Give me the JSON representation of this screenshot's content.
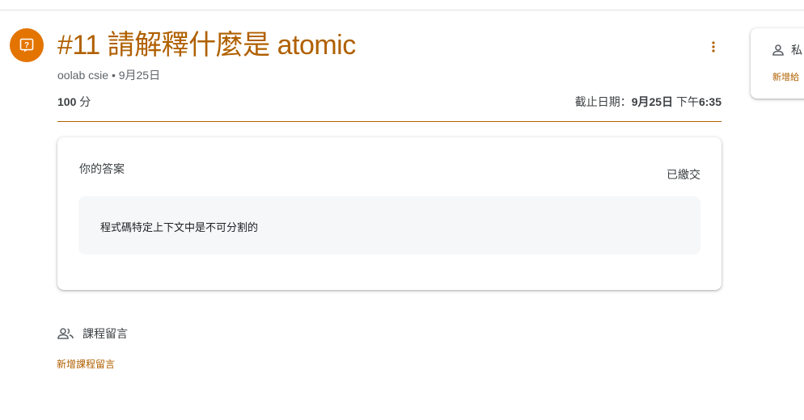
{
  "assignment": {
    "title": "#11 請解釋什麼是 atomic",
    "author": "oolab csie",
    "separator": "•",
    "posted_date": "9月25日",
    "points_value": "100",
    "points_unit": "分",
    "due_label": "截止日期：",
    "due_date": "9月25日",
    "due_period": "下午",
    "due_time": "6:35"
  },
  "answer": {
    "title": "你的答案",
    "status": "已繳交",
    "text": "程式碼特定上下文中是不可分割的"
  },
  "class_comments": {
    "label": "課程留言",
    "add": "新增課程留言"
  },
  "private_comments": {
    "label": "私",
    "add": "新增給"
  },
  "colors": {
    "accent": "#b06000",
    "icon_bg": "#e37400"
  },
  "icons": {
    "assignment": "question-assignment-icon",
    "more": "more-vertical-icon",
    "people": "people-icon",
    "person": "person-icon"
  }
}
